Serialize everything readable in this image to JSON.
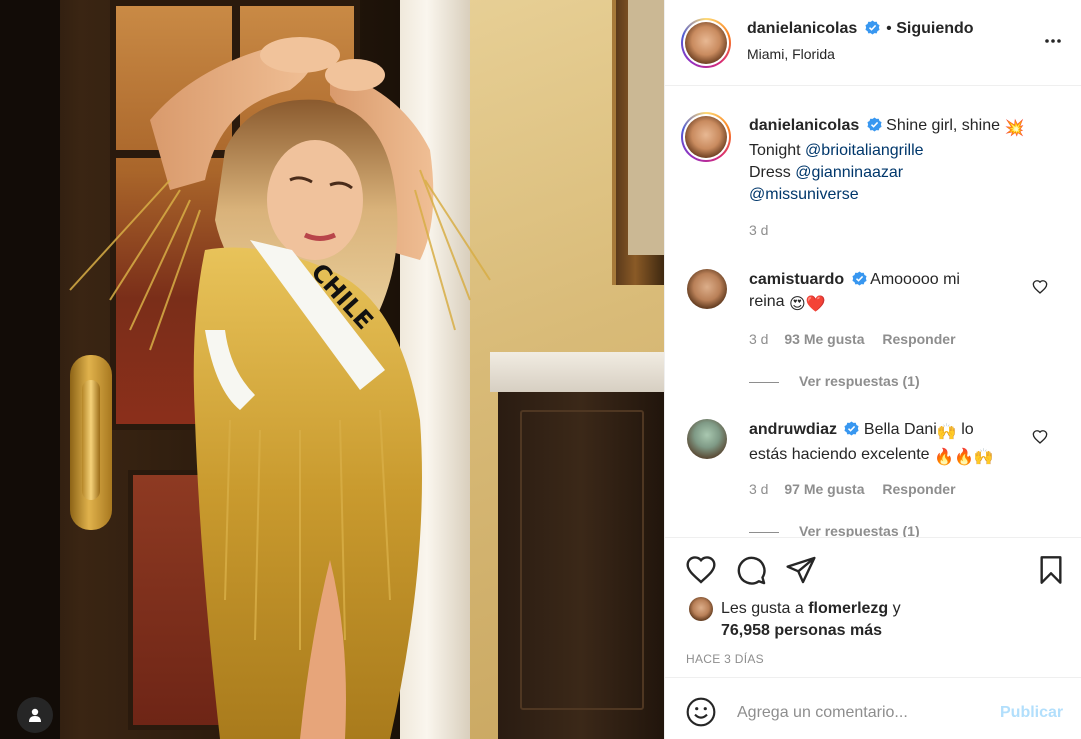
{
  "post": {
    "username": "danielanicolas",
    "follow_sep": "•",
    "follow_status": "Siguiendo",
    "location": "Miami, Florida",
    "more_icon": "more-horizontal-icon"
  },
  "caption": {
    "username": "danielanicolas",
    "text": "Shine girl, shine",
    "emoji": "💥",
    "line2_prefix": "Tonight",
    "line2_link": "@brioitaliangrille",
    "line3_prefix": "Dress",
    "line3_link": "@gianninaazar",
    "line4_link": "@missuniverse",
    "time": "3 d"
  },
  "comments": [
    {
      "username": "camistuardo",
      "text_a": "Amooooo mi",
      "text_b": "reina",
      "emoji": "😍❤️",
      "time": "3 d",
      "likes": "93 Me gusta",
      "reply": "Responder",
      "view_replies": "Ver respuestas (1)"
    },
    {
      "username": "andruwdiaz",
      "text_a": "Bella Dani",
      "emoji_a": "🙌",
      "text_b": "lo",
      "text_c": "estás haciendo excelente",
      "emoji_b": "🔥🔥🙌",
      "time": "3 d",
      "likes": "97 Me gusta",
      "reply": "Responder",
      "view_replies": "Ver respuestas (1)"
    }
  ],
  "likes": {
    "prefix": "Les gusta a",
    "user": "flomerlezg",
    "conj": "y",
    "count": "76,958 personas más"
  },
  "posted": "HACE 3 DÍAS",
  "add_comment": {
    "placeholder": "Agrega un comentario...",
    "publish": "Publicar"
  },
  "photo": {
    "sash_text": "CHILE"
  },
  "colors": {
    "verified": "#3897f0",
    "link": "#00376b",
    "muted": "#8e8e8e",
    "publish_disabled": "#b2dffc",
    "heart_red": "#ed4956"
  }
}
